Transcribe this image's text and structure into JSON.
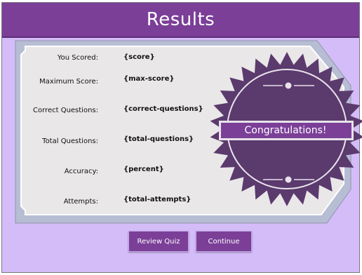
{
  "header": {
    "title": "Results"
  },
  "results": {
    "rows": [
      {
        "label": "You Scored:",
        "value": "{score}"
      },
      {
        "label": "Maximum Score:",
        "value": "{max-score}"
      },
      {
        "label": "Correct Questions:",
        "value": "{correct-questions}"
      },
      {
        "label": "Total Questions:",
        "value": "{total-questions}"
      },
      {
        "label": "Accuracy:",
        "value": "{percent}"
      },
      {
        "label": "Attempts:",
        "value": "{total-attempts}"
      }
    ]
  },
  "seal": {
    "text": "Congratulations!"
  },
  "buttons": {
    "review": "Review Quiz",
    "continue": "Continue"
  },
  "colors": {
    "header": "#7b3f98",
    "background": "#d4bcf9",
    "card": "#e8e6e6",
    "seal": "#5b3a6e",
    "button": "#7b3f98"
  }
}
